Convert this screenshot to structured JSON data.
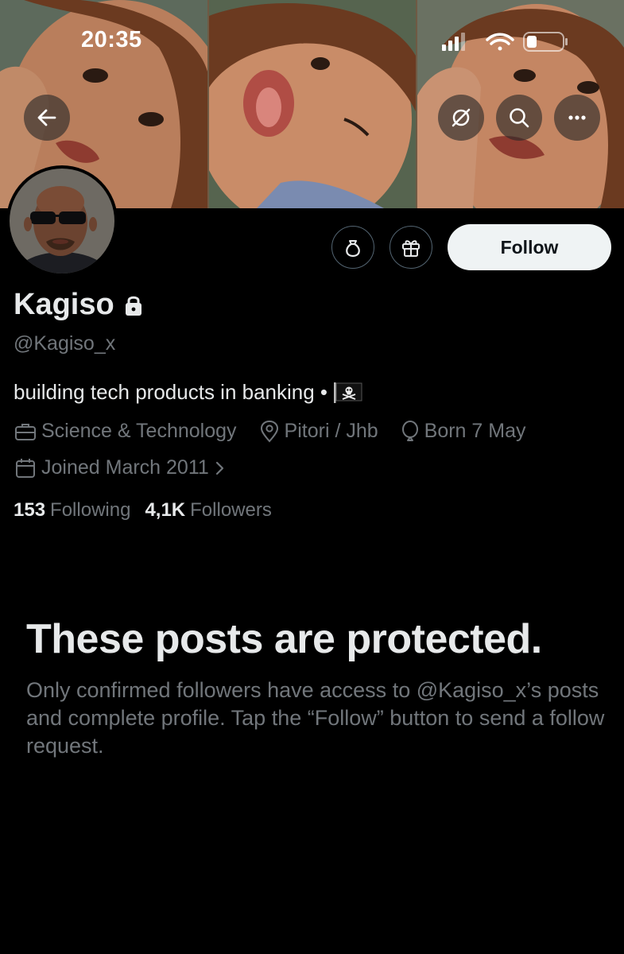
{
  "status_bar": {
    "time": "20:35"
  },
  "header": {
    "back_icon": "arrow-left-icon",
    "icons": [
      "arrows-sync-icon",
      "search-icon",
      "more-horizontal-icon"
    ]
  },
  "profile": {
    "display_name": "Kagiso",
    "locked_icon": "lock-icon",
    "handle": "@Kagiso_x",
    "bio": "building tech products in banking •",
    "bio_emoji": "pirate-flag",
    "category": "Science & Technology",
    "location": "Pitori / Jhb",
    "birthday": "Born 7 May",
    "joined": "Joined March 2011",
    "following_count": "153",
    "following_label": "Following",
    "followers_count": "4,1K",
    "followers_label": "Followers"
  },
  "actions": {
    "follow_label": "Follow",
    "tip_icon": "money-bag-icon",
    "gift_icon": "gift-icon"
  },
  "protected": {
    "title": "These posts are protected.",
    "body": "Only confirmed followers have access to @Kagiso_x’s posts and complete profile. Tap the “Follow” button to send a follow request."
  },
  "colors": {
    "background": "#000000",
    "primary_text": "#e7e9ea",
    "secondary_text": "#71767b",
    "follow_button_bg": "#eff3f4",
    "border": "#536471"
  }
}
